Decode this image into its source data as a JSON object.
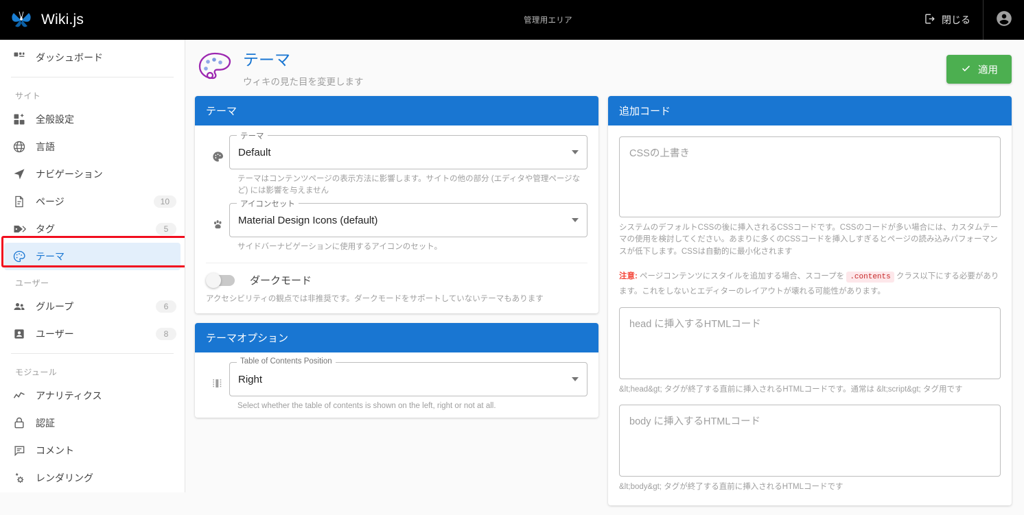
{
  "topbar": {
    "brand": "Wiki.js",
    "logo_icon": "butterfly-logo",
    "admin_area_label": "管理用エリア",
    "close_label": "閉じる",
    "close_icon": "exit-to-app-icon",
    "account_icon": "account-circle-icon"
  },
  "sidebar": {
    "dashboard": {
      "label": "ダッシュボード",
      "icon": "view-dashboard-icon"
    },
    "sections": [
      {
        "title": "サイト",
        "items": [
          {
            "label": "全般設定",
            "icon": "cog-box-icon",
            "badge": ""
          },
          {
            "label": "言語",
            "icon": "web-icon",
            "badge": ""
          },
          {
            "label": "ナビゲーション",
            "icon": "navigation-icon",
            "badge": ""
          },
          {
            "label": "ページ",
            "icon": "file-document-icon",
            "badge": "10"
          },
          {
            "label": "タグ",
            "icon": "tag-multiple-icon",
            "badge": "5"
          },
          {
            "label": "テーマ",
            "icon": "palette-icon",
            "badge": "",
            "active": true
          }
        ]
      },
      {
        "title": "ユーザー",
        "items": [
          {
            "label": "グループ",
            "icon": "account-group-icon",
            "badge": "6"
          },
          {
            "label": "ユーザー",
            "icon": "account-box-icon",
            "badge": "8"
          }
        ]
      },
      {
        "title": "モジュール",
        "items": [
          {
            "label": "アナリティクス",
            "icon": "chart-timeline-variant-icon",
            "badge": ""
          },
          {
            "label": "認証",
            "icon": "lock-icon",
            "badge": ""
          },
          {
            "label": "コメント",
            "icon": "comment-text-icon",
            "badge": ""
          },
          {
            "label": "レンダリング",
            "icon": "cogs-icon",
            "badge": ""
          }
        ]
      }
    ]
  },
  "page": {
    "icon": "palette-icon-large",
    "title": "テーマ",
    "subtitle": "ウィキの見た目を変更します",
    "apply_label": "適用",
    "apply_icon": "check-icon",
    "apply_color": "#4caf50"
  },
  "theme_card": {
    "header": "テーマ",
    "theme_field": {
      "icon": "palette-icon",
      "legend": "テーマ",
      "value": "Default",
      "hint": "テーマはコンテンツページの表示方法に影響します。サイトの他の部分 (エディタや管理ページなど) には影響を与えません"
    },
    "iconset_field": {
      "icon": "paw-icon",
      "legend": "アイコンセット",
      "value": "Material Design Icons (default)",
      "hint": "サイドバーナビゲーションに使用するアイコンのセット。"
    },
    "dark_mode": {
      "label": "ダークモード",
      "enabled": false,
      "hint": "アクセシビリティの観点では非推奨です。ダークモードをサポートしていないテーマもあります"
    }
  },
  "theme_options_card": {
    "header": "テーマオプション",
    "toc_field": {
      "icon": "page-layout-sidebar-right-icon",
      "legend": "Table of Contents Position",
      "value": "Right",
      "hint": "Select whether the table of contents is shown on the left, right or not at all."
    }
  },
  "code_card": {
    "header": "追加コード",
    "css": {
      "placeholder": "CSSの上書き",
      "value": "",
      "hint": "システムのデフォルトCSSの後に挿入されるCSSコードです。CSSのコードが多い場合には、カスタムテーマの使用を検討してください。あまりに多くのCSSコードを挿入しすぎるとページの読み込みパフォーマンスが低下します。CSSは自動的に最小化されます",
      "note_prefix": "注意:",
      "note_part1": " ページコンテンツにスタイルを追加する場合、スコープを ",
      "note_code": ".contents",
      "note_part2": " クラス以下にする必要があります。これをしないとエディターのレイアウトが壊れる可能性があります。"
    },
    "head_html": {
      "placeholder": "head に挿入するHTMLコード",
      "value": "",
      "hint": "&lt;head&gt; タグが終了する直前に挿入されるHTMLコードです。通常は &lt;script&gt; タグ用です"
    },
    "body_html": {
      "placeholder": "body に挿入するHTMLコード",
      "value": "",
      "hint": "&lt;body&gt; タグが終了する直前に挿入されるHTMLコードです"
    }
  },
  "colors": {
    "accent_blue": "#1976d2",
    "topbar": "#000000",
    "active_nav_bg": "#e3effb",
    "highlight_red": "#f10d1e"
  }
}
